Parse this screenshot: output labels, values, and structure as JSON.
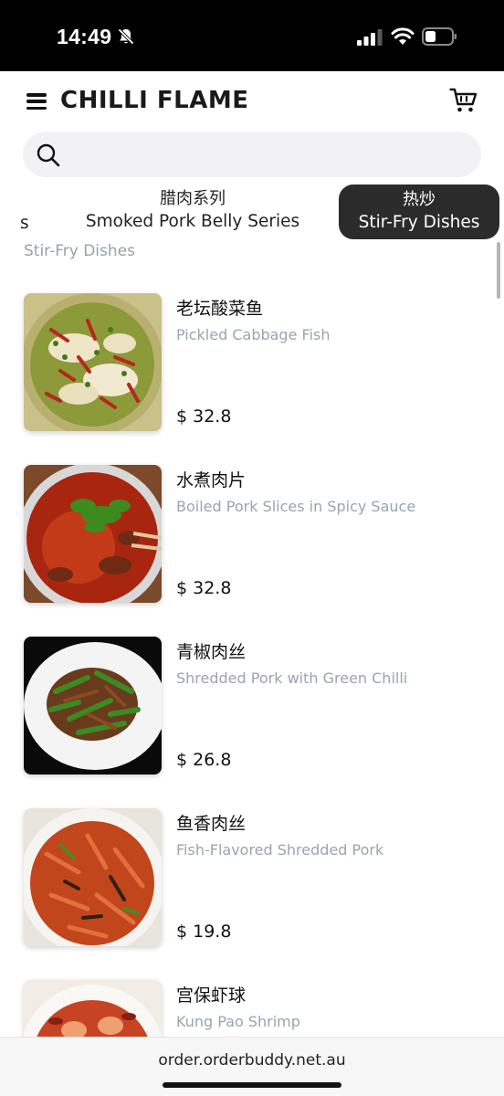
{
  "status": {
    "time": "14:49"
  },
  "header": {
    "brand": "CHILLI FLAME"
  },
  "search": {
    "placeholder": ""
  },
  "categories": [
    {
      "zh": "",
      "en": "s"
    },
    {
      "zh": "腊肉系列",
      "en": "Smoked Pork Belly Series"
    },
    {
      "zh": "热炒",
      "en": "Stir-Fry Dishes",
      "active": true
    }
  ],
  "section": {
    "title": "Stir-Fry Dishes"
  },
  "items": [
    {
      "zh": "老坛酸菜鱼",
      "en": "Pickled Cabbage Fish",
      "price": "$ 32.8"
    },
    {
      "zh": "水煮肉片",
      "en": "Boiled Pork Slices in Spicy Sauce",
      "price": "$ 32.8"
    },
    {
      "zh": "青椒肉丝",
      "en": "Shredded Pork with Green Chilli",
      "price": "$ 26.8"
    },
    {
      "zh": "鱼香肉丝",
      "en": "Fish-Flavored Shredded Pork",
      "price": "$ 19.8"
    },
    {
      "zh": "宫保虾球",
      "en": "Kung Pao Shrimp",
      "price": ""
    }
  ],
  "browser": {
    "url": "order.orderbuddy.net.au"
  },
  "colors": {
    "active_tab_bg": "#2b2b2b",
    "secondary_text": "#9aa3b2"
  }
}
